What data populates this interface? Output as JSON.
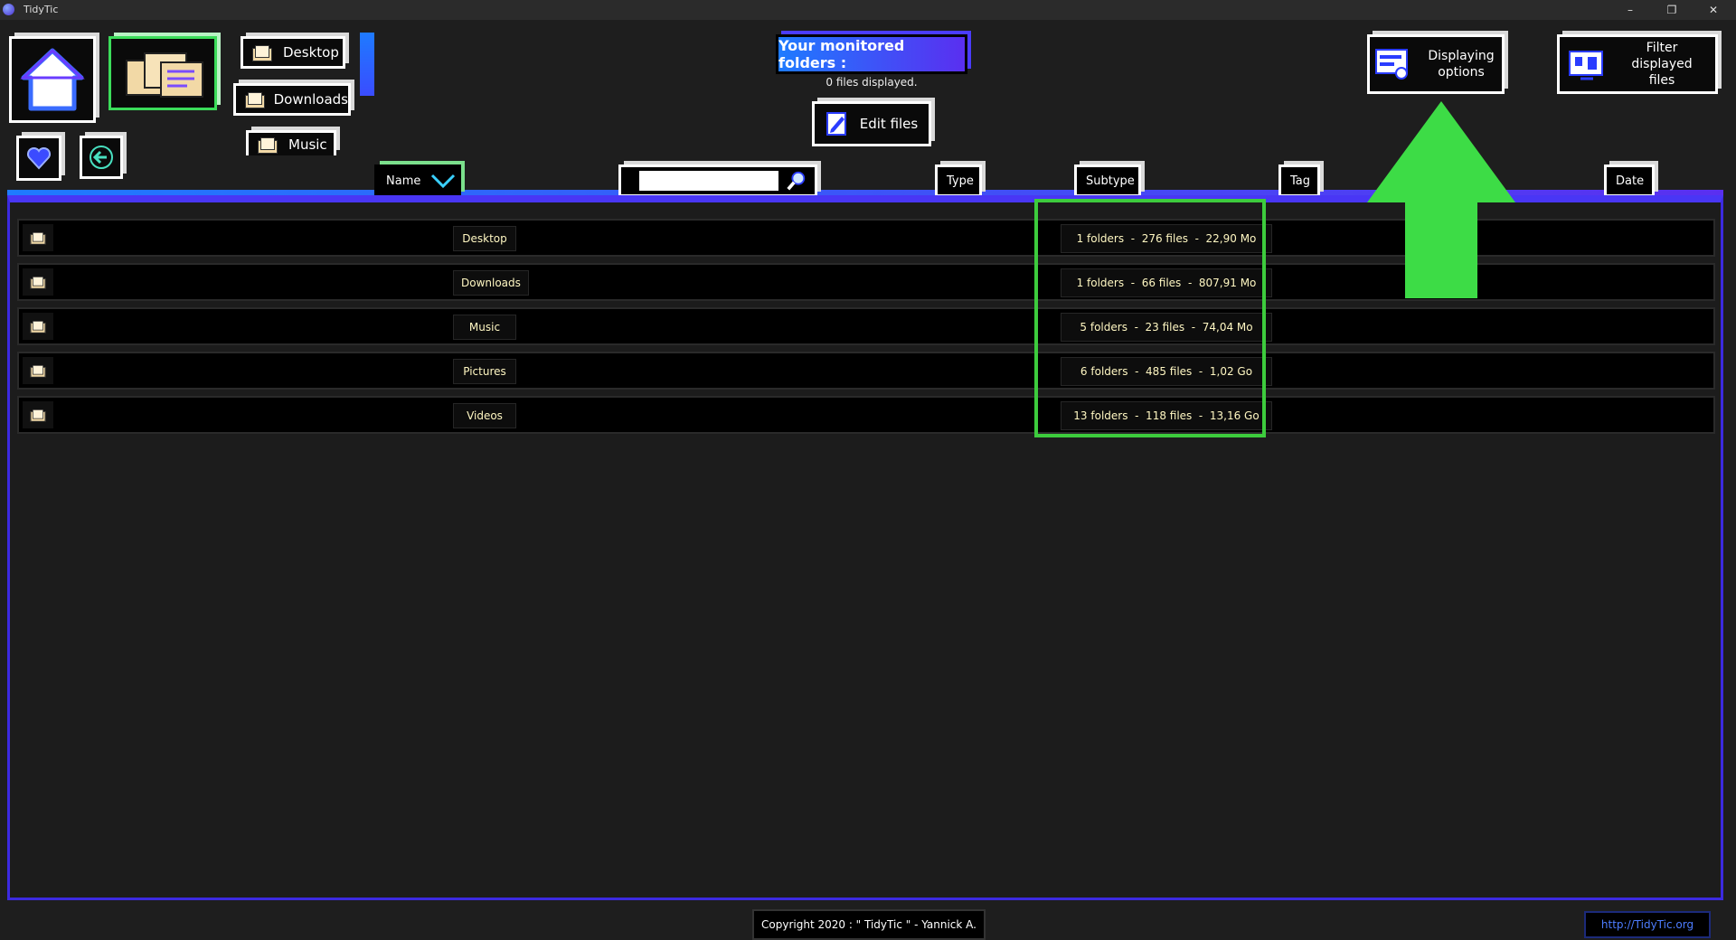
{
  "window": {
    "title": "TidyTic",
    "controls": {
      "minimize": "–",
      "restore": "❐",
      "close": "✕"
    }
  },
  "toolbar": {
    "quick_access": [
      "Desktop",
      "Downloads",
      "Music"
    ],
    "monitored_title": "Your monitored folders :",
    "files_displayed": "0 files displayed.",
    "edit_files_label": "Edit files",
    "displaying_options_label": "Displaying options",
    "filter_label": "Filter displayed files"
  },
  "columns": {
    "name": "Name",
    "type": "Type",
    "subtype": "Subtype",
    "tag": "Tag",
    "date": "Date",
    "search_value": ""
  },
  "rows": [
    {
      "name": "Desktop",
      "summary": "1 folders  -  276 files  -  22,90 Mo"
    },
    {
      "name": "Downloads",
      "summary": "1 folders  -  66 files  -  807,91 Mo"
    },
    {
      "name": "Music",
      "summary": "5 folders  -  23 files  -  74,04 Mo"
    },
    {
      "name": "Pictures",
      "summary": "6 folders  -  485 files  -  1,02 Go"
    },
    {
      "name": "Videos",
      "summary": "13 folders  -  118 files  -  13,16 Go"
    }
  ],
  "footer": {
    "copyright": "Copyright 2020 : \" TidyTic \" - Yannick A.",
    "link": "http://TidyTic.org"
  },
  "colors": {
    "accent_blue": "#1e7bff",
    "accent_purple": "#5a2ff0",
    "highlight_green": "#3dcc3d",
    "row_text": "#fff7c2"
  }
}
